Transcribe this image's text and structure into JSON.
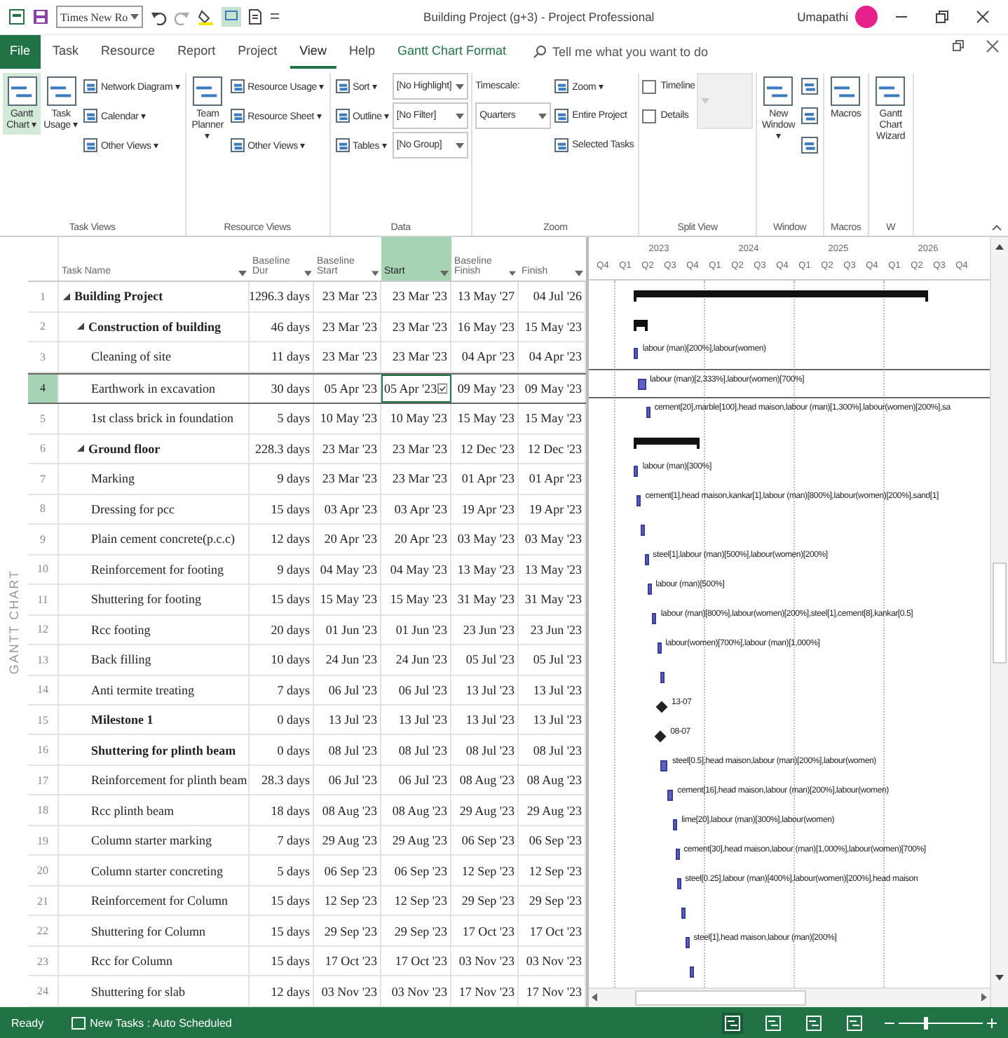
{
  "window": {
    "title": "Building Project (g+3)  -  Project Professional",
    "font_box": "Times New Ro",
    "user": "Umapathi"
  },
  "tabs": [
    {
      "label": "File",
      "kind": "file",
      "selected": false
    },
    {
      "label": "Task",
      "kind": "tab",
      "selected": false
    },
    {
      "label": "Resource",
      "kind": "tab",
      "selected": false
    },
    {
      "label": "Report",
      "kind": "tab",
      "selected": false
    },
    {
      "label": "Project",
      "kind": "tab",
      "selected": false
    },
    {
      "label": "View",
      "kind": "tab",
      "selected": true
    },
    {
      "label": "Help",
      "kind": "tab",
      "selected": false
    },
    {
      "label": "Gantt Chart Format",
      "kind": "contextual",
      "selected": false
    }
  ],
  "search": {
    "placeholder": "Tell me what you want to do"
  },
  "ribbon": [
    {
      "label": "Task Views",
      "columns": [
        [
          {
            "kind": "large",
            "label": "Gantt Chart ▾",
            "selected": true
          }
        ],
        [
          {
            "kind": "large",
            "label": "Task Usage ▾",
            "selected": false
          }
        ],
        [
          {
            "kind": "small",
            "label": "Network Diagram ▾"
          },
          {
            "kind": "small",
            "label": "Calendar ▾"
          },
          {
            "kind": "small",
            "label": "Other Views ▾"
          }
        ]
      ]
    },
    {
      "label": "Resource Views",
      "columns": [
        [
          {
            "kind": "large",
            "label": "Team Planner ▾",
            "selected": false
          }
        ],
        [
          {
            "kind": "small",
            "label": "Resource Usage ▾"
          },
          {
            "kind": "small",
            "label": "Resource Sheet ▾"
          },
          {
            "kind": "small",
            "label": "Other Views ▾"
          }
        ]
      ]
    },
    {
      "label": "Data",
      "columns": [
        [
          {
            "kind": "small",
            "label": "Sort ▾"
          },
          {
            "kind": "small",
            "label": "Outline ▾"
          },
          {
            "kind": "small",
            "label": "Tables ▾"
          }
        ],
        [
          {
            "kind": "dropdown",
            "value": "[No Highlight]",
            "disabled": false
          },
          {
            "kind": "dropdown",
            "value": "[No Filter]",
            "disabled": false
          },
          {
            "kind": "dropdown",
            "value": "[No Group]",
            "disabled": false
          }
        ]
      ]
    },
    {
      "label": "Zoom",
      "columns": [
        [
          {
            "kind": "text",
            "label": "Timescale:"
          },
          {
            "kind": "dropdown",
            "value": "Quarters",
            "disabled": false
          }
        ],
        [
          {
            "kind": "small",
            "label": "Zoom ▾"
          },
          {
            "kind": "small",
            "label": "Entire Project"
          },
          {
            "kind": "small",
            "label": "Selected Tasks"
          }
        ]
      ]
    },
    {
      "label": "Split View",
      "columns": [
        [
          {
            "kind": "checkbox",
            "label": "Timeline",
            "checked": false
          },
          {
            "kind": "checkbox",
            "label": "Details",
            "checked": false
          }
        ],
        [
          {
            "kind": "dropdown",
            "disabled": true
          }
        ]
      ]
    },
    {
      "label": "Window",
      "columns": [
        [
          {
            "kind": "large",
            "label": "New Window ▾",
            "selected": false
          }
        ],
        [
          {
            "kind": "icon"
          },
          {
            "kind": "icon"
          },
          {
            "kind": "icon"
          }
        ]
      ]
    },
    {
      "label": "Macros",
      "columns": [
        [
          {
            "kind": "large",
            "label": "Macros",
            "selected": false
          }
        ]
      ]
    },
    {
      "label": "W",
      "columns": [
        [
          {
            "kind": "large",
            "label": "Gantt Chart Wizard",
            "selected": false
          }
        ]
      ]
    }
  ],
  "view_label": "GANTT CHART",
  "columns": [
    {
      "label": "Task Name",
      "selected": false
    },
    {
      "label": "Baseline Dur",
      "selected": false
    },
    {
      "label": "Baseline Start",
      "selected": false
    },
    {
      "label": "Start",
      "selected": true
    },
    {
      "label": "Baseline Finish",
      "selected": false
    },
    {
      "label": "Finish",
      "selected": false
    }
  ],
  "timescale": {
    "years": [
      "2023",
      "2024",
      "2025",
      "2026"
    ],
    "quarters": [
      "Q4",
      "Q1",
      "Q2",
      "Q3",
      "Q4",
      "Q1",
      "Q2",
      "Q3",
      "Q4",
      "Q1",
      "Q2",
      "Q3",
      "Q4",
      "Q1",
      "Q2",
      "Q3",
      "Q4"
    ]
  },
  "tasks": [
    {
      "id": "1",
      "name": "Building Project",
      "kind": "summary",
      "expanded": true,
      "selected": false,
      "baseline_dur": "1296.3 days",
      "baseline_start": "23 Mar '23",
      "start": "23 Mar '23",
      "baseline_finish": "13 May '27",
      "finish": "04 Jul '26",
      "children": [
        {
          "id": "2",
          "name": "Construction of building",
          "kind": "summary",
          "expanded": true,
          "selected": false,
          "baseline_dur": "46 days",
          "baseline_start": "23 Mar '23",
          "start": "23 Mar '23",
          "baseline_finish": "16 May '23",
          "finish": "15 May '23",
          "children": [
            {
              "id": "3",
              "name": "Cleaning of site",
              "kind": "task",
              "selected": false,
              "baseline_dur": "11 days",
              "baseline_start": "23 Mar '23",
              "start": "23 Mar '23",
              "baseline_finish": "04 Apr '23",
              "finish": "04 Apr '23",
              "bar_label": "labour (man)[200%],labour(women)"
            },
            {
              "id": "4",
              "name": "Earthwork in excavation",
              "kind": "task",
              "selected": true,
              "baseline_dur": "30 days",
              "baseline_start": "05 Apr '23",
              "start": "05 Apr '23",
              "baseline_finish": "09 May '23",
              "finish": "09 May '23",
              "bar_label": "labour (man)[2,333%],labour(women)[700%]"
            },
            {
              "id": "5",
              "name": "1st class brick in foundation",
              "kind": "task",
              "selected": false,
              "baseline_dur": "5 days",
              "baseline_start": "10 May '23",
              "start": "10 May '23",
              "baseline_finish": "15 May '23",
              "finish": "15 May '23",
              "bar_label": "cement[20],marble[100],head maison,labour (man)[1,300%],labour(women)[200%],sa"
            }
          ]
        },
        {
          "id": "6",
          "name": "Ground floor",
          "kind": "summary",
          "expanded": true,
          "selected": false,
          "baseline_dur": "228.3 days",
          "baseline_start": "23 Mar '23",
          "start": "23 Mar '23",
          "baseline_finish": "12 Dec '23",
          "finish": "12 Dec '23",
          "children": [
            {
              "id": "7",
              "name": "Marking",
              "kind": "task",
              "selected": false,
              "baseline_dur": "9 days",
              "baseline_start": "23 Mar '23",
              "start": "23 Mar '23",
              "baseline_finish": "01 Apr '23",
              "finish": "01 Apr '23",
              "bar_label": "labour (man)[300%]"
            },
            {
              "id": "8",
              "name": "Dressing for pcc",
              "kind": "task",
              "selected": false,
              "baseline_dur": "15 days",
              "baseline_start": "03 Apr '23",
              "start": "03 Apr '23",
              "baseline_finish": "19 Apr '23",
              "finish": "19 Apr '23",
              "bar_label": "cement[1],head maison,kankar[1],labour (man)[800%],labour(women)[200%],sand[1]"
            },
            {
              "id": "9",
              "name": "Plain cement concrete(p.c.c)",
              "kind": "task",
              "selected": false,
              "baseline_dur": "12 days",
              "baseline_start": "20 Apr '23",
              "start": "20 Apr '23",
              "baseline_finish": "03 May '23",
              "finish": "03 May '23"
            },
            {
              "id": "10",
              "name": "Reinforcement for footing",
              "kind": "task",
              "selected": false,
              "baseline_dur": "9 days",
              "baseline_start": "04 May '23",
              "start": "04 May '23",
              "baseline_finish": "13 May '23",
              "finish": "13 May '23",
              "bar_label": "steel[1],labour (man)[500%],labour(women)[200%]"
            },
            {
              "id": "11",
              "name": "Shuttering for footing",
              "kind": "task",
              "selected": false,
              "baseline_dur": "15 days",
              "baseline_start": "15 May '23",
              "start": "15 May '23",
              "baseline_finish": "31 May '23",
              "finish": "31 May '23",
              "bar_label": "labour (man)[500%]"
            },
            {
              "id": "12",
              "name": "Rcc footing",
              "kind": "task",
              "selected": false,
              "baseline_dur": "20 days",
              "baseline_start": "01 Jun '23",
              "start": "01 Jun '23",
              "baseline_finish": "23 Jun '23",
              "finish": "23 Jun '23",
              "bar_label": "labour (man)[800%],labour(women)[200%],steel[1],cement[8],kankar[0.5]"
            },
            {
              "id": "13",
              "name": "Back filling",
              "kind": "task",
              "selected": false,
              "baseline_dur": "10 days",
              "baseline_start": "24 Jun '23",
              "start": "24 Jun '23",
              "baseline_finish": "05 Jul '23",
              "finish": "05 Jul '23",
              "bar_label": "labour(women)[700%],labour (man)[1,000%]"
            },
            {
              "id": "14",
              "name": "Anti termite treating",
              "kind": "task",
              "selected": false,
              "baseline_dur": "7 days",
              "baseline_start": "06 Jul '23",
              "start": "06 Jul '23",
              "baseline_finish": "13 Jul '23",
              "finish": "13 Jul '23"
            },
            {
              "id": "15",
              "name": "Milestone 1",
              "kind": "milestone",
              "selected": false,
              "baseline_dur": "0 days",
              "baseline_start": "13 Jul '23",
              "start": "13 Jul '23",
              "baseline_finish": "13 Jul '23",
              "finish": "13 Jul '23",
              "bar_label": "13-07"
            },
            {
              "id": "16",
              "name": "Shuttering for plinth beam",
              "kind": "milestone",
              "selected": false,
              "baseline_dur": "0 days",
              "baseline_start": "08 Jul '23",
              "start": "08 Jul '23",
              "baseline_finish": "08 Jul '23",
              "finish": "08 Jul '23",
              "bar_label": "08-07"
            },
            {
              "id": "17",
              "name": "Reinforcement for plinth beam",
              "kind": "task",
              "selected": false,
              "baseline_dur": "28.3 days",
              "baseline_start": "06 Jul '23",
              "start": "06 Jul '23",
              "baseline_finish": "08 Aug '23",
              "finish": "08 Aug '23",
              "bar_label": "steel[0.5],head maison,labour (man)[200%],labour(women)"
            },
            {
              "id": "18",
              "name": "Rcc plinth beam",
              "kind": "task",
              "selected": false,
              "baseline_dur": "18 days",
              "baseline_start": "08 Aug '23",
              "start": "08 Aug '23",
              "baseline_finish": "29 Aug '23",
              "finish": "29 Aug '23",
              "bar_label": "cement[16],head maison,labour (man)[200%],labour(women)"
            },
            {
              "id": "19",
              "name": "Column starter marking",
              "kind": "task",
              "selected": false,
              "baseline_dur": "7 days",
              "baseline_start": "29 Aug '23",
              "start": "29 Aug '23",
              "baseline_finish": "06 Sep '23",
              "finish": "06 Sep '23",
              "bar_label": "lime[20],labour (man)[300%],labour(women)"
            },
            {
              "id": "20",
              "name": "Column starter concreting",
              "kind": "task",
              "selected": false,
              "baseline_dur": "5 days",
              "baseline_start": "06 Sep '23",
              "start": "06 Sep '23",
              "baseline_finish": "12 Sep '23",
              "finish": "12 Sep '23",
              "bar_label": "cement[30],head maison,labour (man)[1,000%],labour(women)[700%]"
            },
            {
              "id": "21",
              "name": "Reinforcement for Column",
              "kind": "task",
              "selected": false,
              "baseline_dur": "15 days",
              "baseline_start": "12 Sep '23",
              "start": "12 Sep '23",
              "baseline_finish": "29 Sep '23",
              "finish": "29 Sep '23",
              "bar_label": "steel[0.25],labour (man)[400%],labour(women)[200%],head maison"
            },
            {
              "id": "22",
              "name": "Shuttering for Column",
              "kind": "task",
              "selected": false,
              "baseline_dur": "15 days",
              "baseline_start": "29 Sep '23",
              "start": "29 Sep '23",
              "baseline_finish": "17 Oct '23",
              "finish": "17 Oct '23"
            },
            {
              "id": "23",
              "name": "Rcc for Column",
              "kind": "task",
              "selected": false,
              "baseline_dur": "15 days",
              "baseline_start": "17 Oct '23",
              "start": "17 Oct '23",
              "baseline_finish": "03 Nov '23",
              "finish": "03 Nov '23",
              "bar_label": "steel[1],head maison,labour (man)[200%]"
            },
            {
              "id": "24",
              "name": "Shuttering for slab",
              "kind": "task",
              "selected": false,
              "baseline_dur": "12 days",
              "baseline_start": "03 Nov '23",
              "start": "03 Nov '23",
              "baseline_finish": "17 Nov '23",
              "finish": "17 Nov '23"
            }
          ]
        }
      ]
    }
  ],
  "status_bar": {
    "state": "Ready",
    "new_tasks": "New Tasks : Auto Scheduled",
    "zoom": {
      "level": 0.3
    }
  }
}
